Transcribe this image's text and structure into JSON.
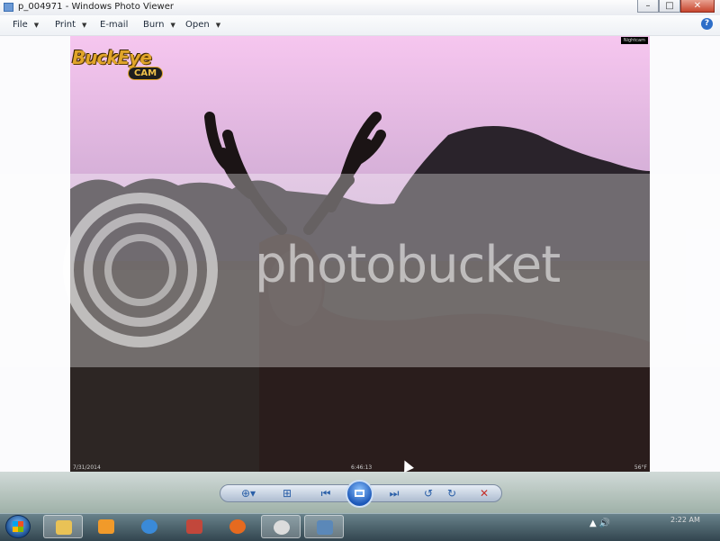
{
  "window": {
    "title": "p_004971 - Windows Photo Viewer",
    "min_label": "–",
    "max_label": "□",
    "close_label": "✕"
  },
  "menu": {
    "items": [
      {
        "label": "File"
      },
      {
        "label": "Print"
      },
      {
        "label": "E-mail"
      },
      {
        "label": "Burn"
      },
      {
        "label": "Open"
      }
    ],
    "caret": "▼",
    "help_label": "?"
  },
  "photo": {
    "logo_text": "BuckEye",
    "logo_sub": "CAM",
    "corner_tag": "Nightcam",
    "date": "7/31/2014",
    "time": "6:46:13",
    "temp": "56°F",
    "watermark": "photobucket",
    "sky_color": "#f6c6ef",
    "ground_color": "#241b1c"
  },
  "controls": {
    "zoom_icon": "zoom-icon",
    "fit_icon": "actual-size-icon",
    "prev_icon": "previous-icon",
    "slideshow_icon": "slideshow-icon",
    "next_icon": "next-icon",
    "rotate_ccw_icon": "rotate-left-icon",
    "rotate_cw_icon": "rotate-right-icon",
    "delete_icon": "delete-icon"
  },
  "taskbar": {
    "clock": "2:22 AM"
  }
}
